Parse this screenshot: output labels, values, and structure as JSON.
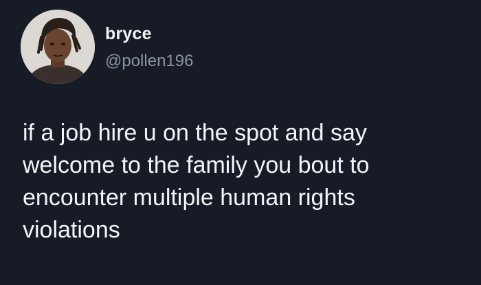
{
  "user": {
    "display_name": "bryce",
    "handle": "@pollen196",
    "avatar_icon": "profile-photo"
  },
  "tweet": {
    "text_lines": [
      "if a job hire u on the spot and say",
      "welcome to the family you bout to",
      "encounter multiple human rights",
      "violations"
    ]
  },
  "colors": {
    "background": "#161b26",
    "text": "#f4f5f7",
    "handle": "#8b95a3"
  }
}
